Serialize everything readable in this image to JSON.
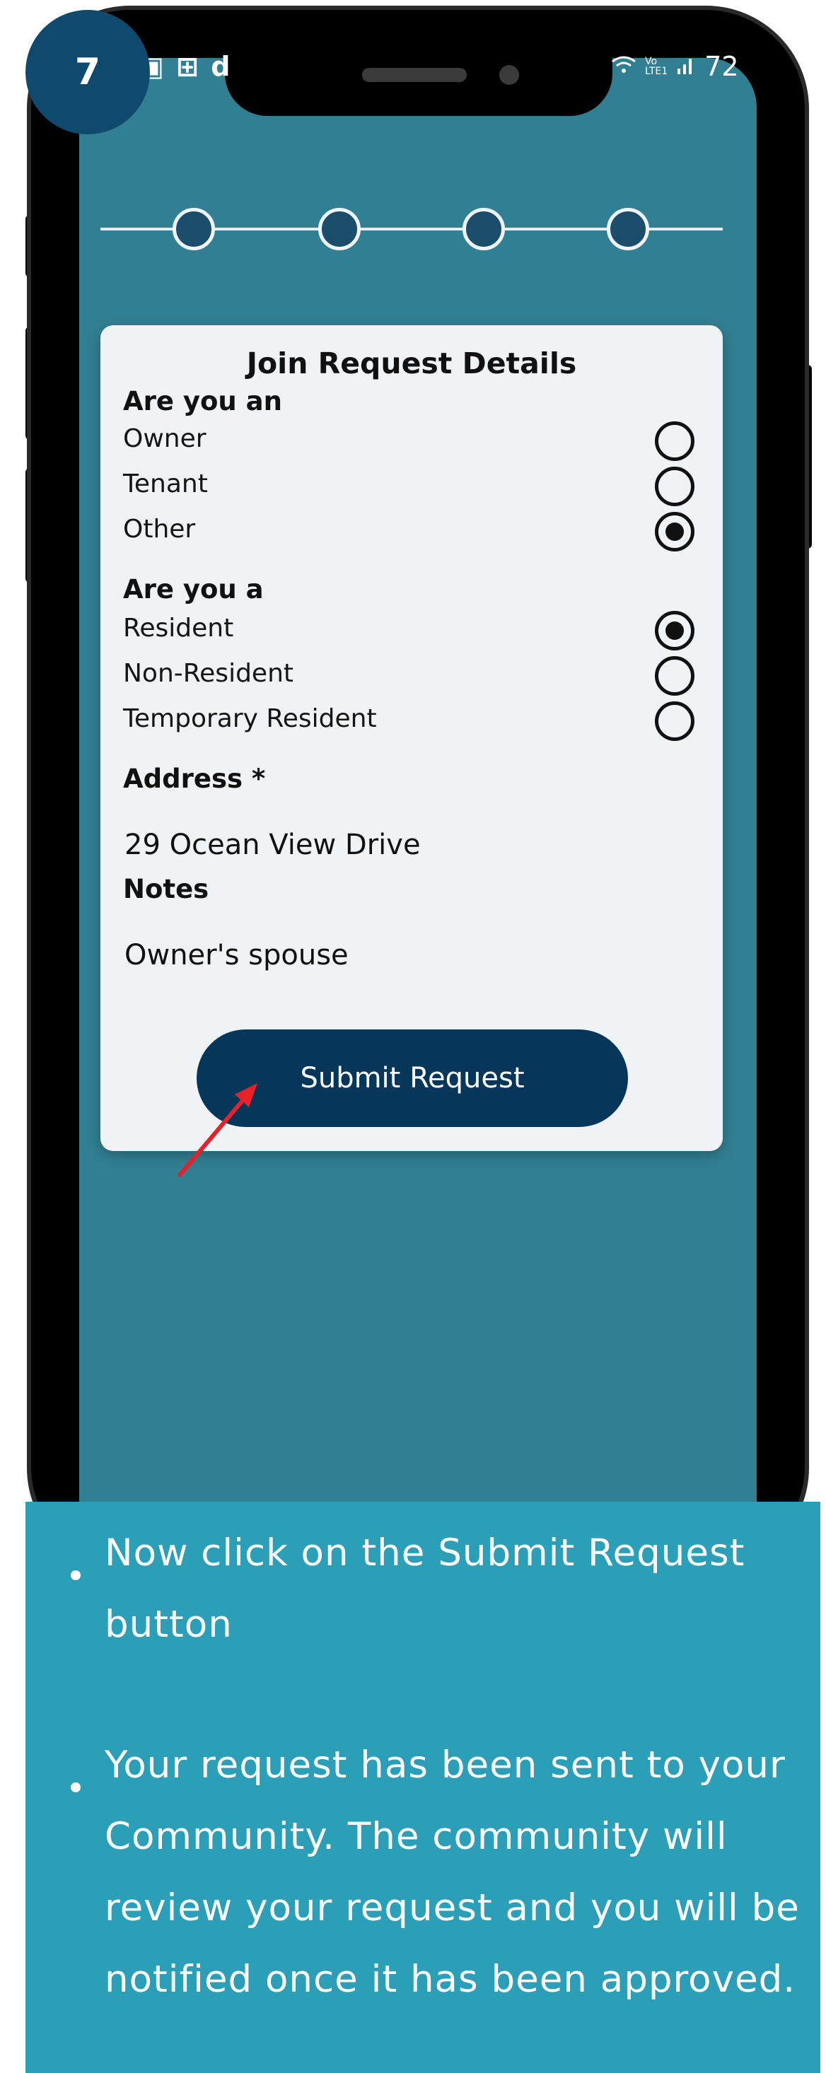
{
  "step_badge": "7",
  "status_bar": {
    "left_text": "▣ ⊞ d",
    "signal_label_top": "Vo",
    "signal_label_bottom": "LTE1",
    "battery": "72"
  },
  "stepper": {
    "steps": [
      "step-1",
      "step-2",
      "step-3",
      "step-4"
    ]
  },
  "form": {
    "title": "Join Request Details",
    "question_role": "Are you an",
    "role_options": [
      {
        "label": "Owner",
        "checked": false
      },
      {
        "label": "Tenant",
        "checked": false
      },
      {
        "label": "Other",
        "checked": true
      }
    ],
    "question_residency": "Are you a",
    "residency_options": [
      {
        "label": "Resident",
        "checked": true
      },
      {
        "label": "Non-Resident",
        "checked": false
      },
      {
        "label": "Temporary Resident",
        "checked": false
      }
    ],
    "address_label": "Address *",
    "address_value": "29 Ocean View Drive",
    "notes_label": "Notes",
    "notes_value": "Owner's spouse",
    "submit_label": "Submit Request"
  },
  "instructions": [
    "Now click on the Submit Request button",
    "Your request has been sent to your Community. The community will review your request and you will be notified once it has been approved."
  ],
  "colors": {
    "screen_bg": "#317f92",
    "button_bg": "#06375a",
    "panel_bg": "#2c9fb8",
    "badge_bg": "#0f4a6e",
    "arrow": "#e8202a"
  }
}
